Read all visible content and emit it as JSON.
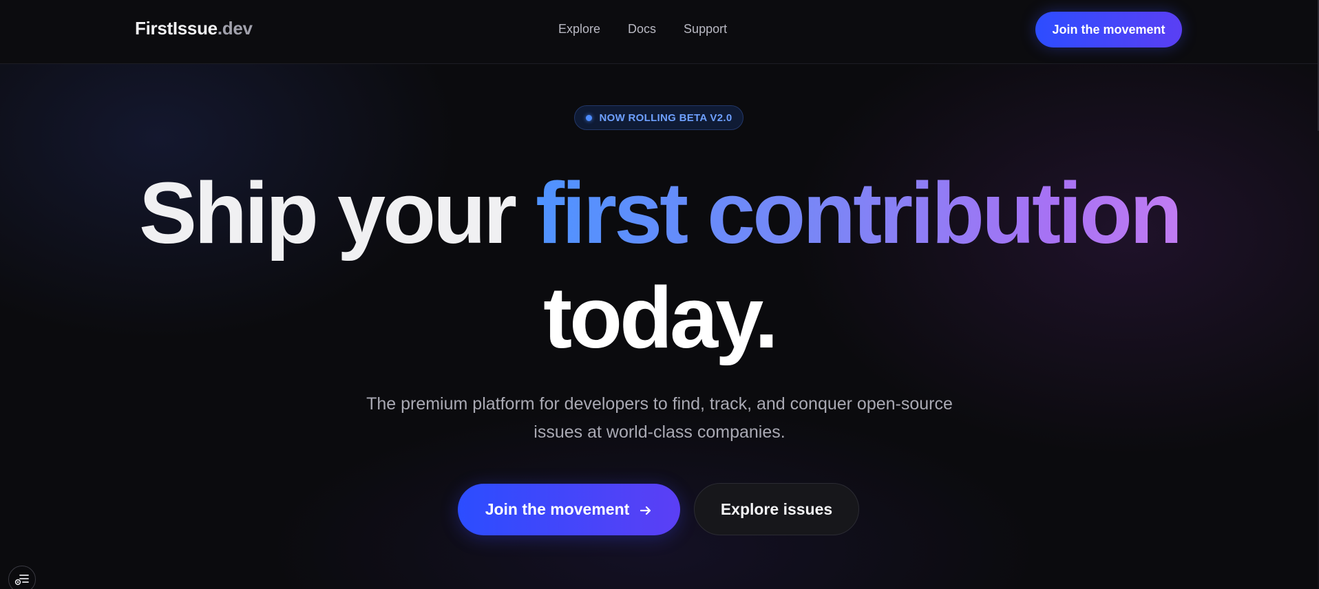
{
  "header": {
    "brand_main": "FirstIssue",
    "brand_tld": ".dev",
    "nav": [
      "Explore",
      "Docs",
      "Support"
    ],
    "cta_label": "Join the movement"
  },
  "hero": {
    "badge_label": "NOW ROLLING BETA V2.0",
    "headline_part1": "Ship your ",
    "headline_highlight": "first contribution",
    "headline_part2": "today.",
    "subtitle": "The premium platform for developers to find, track, and conquer open-source issues at world-class companies.",
    "primary_cta": "Join the movement",
    "secondary_cta": "Explore issues"
  },
  "icons": {
    "primary_cta_icon": "arrow-right-icon",
    "floating_button_icon": "settings-list-icon"
  },
  "colors": {
    "background": "#0b0b0e",
    "accent_start": "#2d4dff",
    "accent_end": "#5a3ff4",
    "gradient_blue": "#4f93ff",
    "gradient_purple": "#c07cf2",
    "badge_text": "#6ea0ff"
  }
}
